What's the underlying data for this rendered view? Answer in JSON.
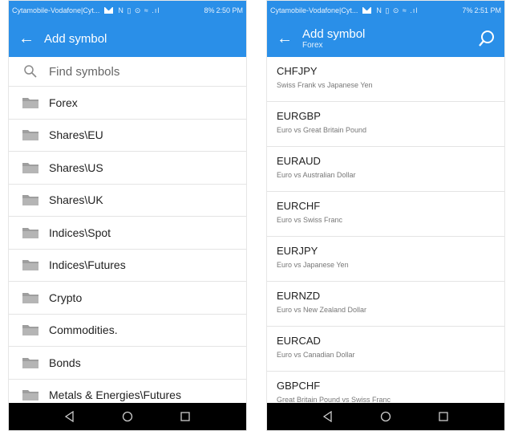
{
  "colors": {
    "accent": "#2a8fe8",
    "nav_bar": "#000000",
    "folder_icon": "#9e9e9e"
  },
  "left": {
    "status": {
      "carrier": "Cytamobile-Vodafone|Cyt...",
      "sys_icons": "N ▯ ⊙ ≈ .ıl",
      "battery": "8%",
      "time": "2:50 PM"
    },
    "app_bar": {
      "back_icon": "arrow-left-icon",
      "title": "Add symbol"
    },
    "search": {
      "icon": "search-icon",
      "placeholder": "Find symbols"
    },
    "folders": [
      {
        "label": "Forex"
      },
      {
        "label": "Shares\\EU"
      },
      {
        "label": "Shares\\US"
      },
      {
        "label": "Shares\\UK"
      },
      {
        "label": "Indices\\Spot"
      },
      {
        "label": "Indices\\Futures"
      },
      {
        "label": "Crypto"
      },
      {
        "label": "Commodities."
      },
      {
        "label": "Bonds"
      },
      {
        "label": "Metals & Energies\\Futures"
      }
    ]
  },
  "right": {
    "status": {
      "carrier": "Cytamobile-Vodafone|Cyt...",
      "sys_icons": "N ▯ ⊙ ≈ .ıl",
      "battery": "7%",
      "time": "2:51 PM"
    },
    "app_bar": {
      "back_icon": "arrow-left-icon",
      "title": "Add symbol",
      "subtitle": "Forex",
      "search_icon": "search-icon"
    },
    "symbols": [
      {
        "code": "CHFJPY",
        "desc": "Swiss Frank vs Japanese Yen"
      },
      {
        "code": "EURGBP",
        "desc": "Euro vs Great Britain Pound"
      },
      {
        "code": "EURAUD",
        "desc": "Euro vs Australian Dollar"
      },
      {
        "code": "EURCHF",
        "desc": "Euro vs Swiss Franc"
      },
      {
        "code": "EURJPY",
        "desc": "Euro vs Japanese Yen"
      },
      {
        "code": "EURNZD",
        "desc": "Euro vs New Zealand Dollar"
      },
      {
        "code": "EURCAD",
        "desc": "Euro vs Canadian Dollar"
      },
      {
        "code": "GBPCHF",
        "desc": "Great Britain Pound vs Swiss Franc"
      }
    ]
  },
  "nav_bar": {
    "back": "nav-back-icon",
    "home": "nav-home-icon",
    "recents": "nav-recents-icon"
  }
}
